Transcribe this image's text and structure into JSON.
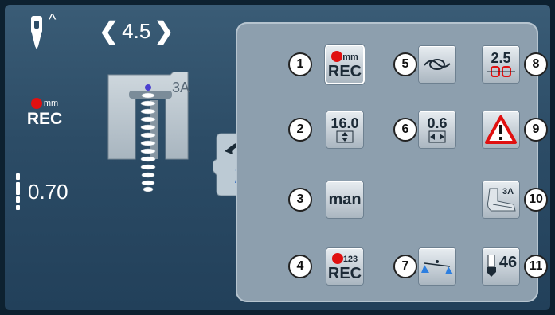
{
  "left": {
    "caret_icon": "^",
    "stitch_width": "4.5",
    "width_left_icon": "chevron-left-icon",
    "width_right_icon": "chevron-right-icon",
    "rec_unit": "mm",
    "rec_label": "REC",
    "stitch_length": "0.70",
    "foot_label": "3A"
  },
  "panel": {
    "buttons": [
      {
        "num": "1",
        "top": "mm",
        "main": "REC"
      },
      {
        "num": "2",
        "value": "16.0"
      },
      {
        "num": "3",
        "main": "man"
      },
      {
        "num": "4",
        "top": "123",
        "main": "REC"
      },
      {
        "num": "5",
        "icon": "securing-knot-icon"
      },
      {
        "num": "6",
        "value": "0.6"
      },
      {
        "num": "7",
        "icon": "balance-icon"
      },
      {
        "num": "8",
        "value": "2.5"
      },
      {
        "num": "9",
        "icon": "warning-icon"
      },
      {
        "num": "10",
        "foot": "3A"
      },
      {
        "num": "11",
        "value": "46"
      }
    ]
  },
  "colors": {
    "background": "#2c4c66",
    "panel": "#8d9fae",
    "rec_dot": "#e01010",
    "warning": "#e01010",
    "info_blue": "#1f5fbf"
  }
}
